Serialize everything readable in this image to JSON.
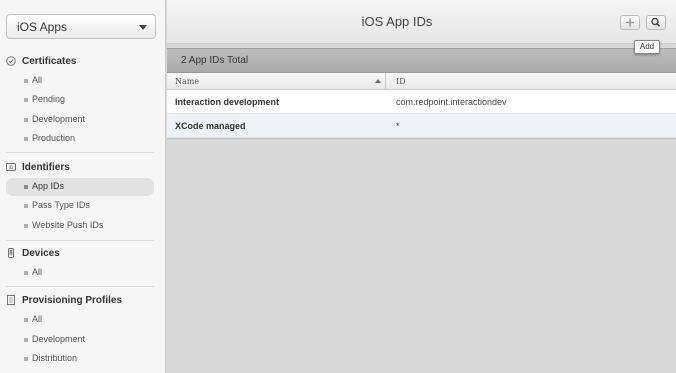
{
  "sidebar": {
    "platform": "iOS Apps",
    "sections": [
      {
        "title": "Certificates",
        "icon": "certificate-icon",
        "items": [
          "All",
          "Pending",
          "Development",
          "Production"
        ]
      },
      {
        "title": "Identifiers",
        "icon": "id-icon",
        "items": [
          "App IDs",
          "Pass Type IDs",
          "Website Push IDs"
        ]
      },
      {
        "title": "Devices",
        "icon": "device-icon",
        "items": [
          "All"
        ]
      },
      {
        "title": "Provisioning Profiles",
        "icon": "document-icon",
        "items": [
          "All",
          "Development",
          "Distribution"
        ]
      }
    ],
    "active_item": "App IDs"
  },
  "header": {
    "title": "iOS App IDs",
    "add_tooltip": "Add"
  },
  "summary": "2 App IDs Total",
  "table": {
    "columns": [
      "Name",
      "ID"
    ],
    "rows": [
      {
        "name": "Interaction development",
        "id": "com.redpoint.interactiondev"
      },
      {
        "name": "XCode managed",
        "id": "*"
      }
    ]
  }
}
